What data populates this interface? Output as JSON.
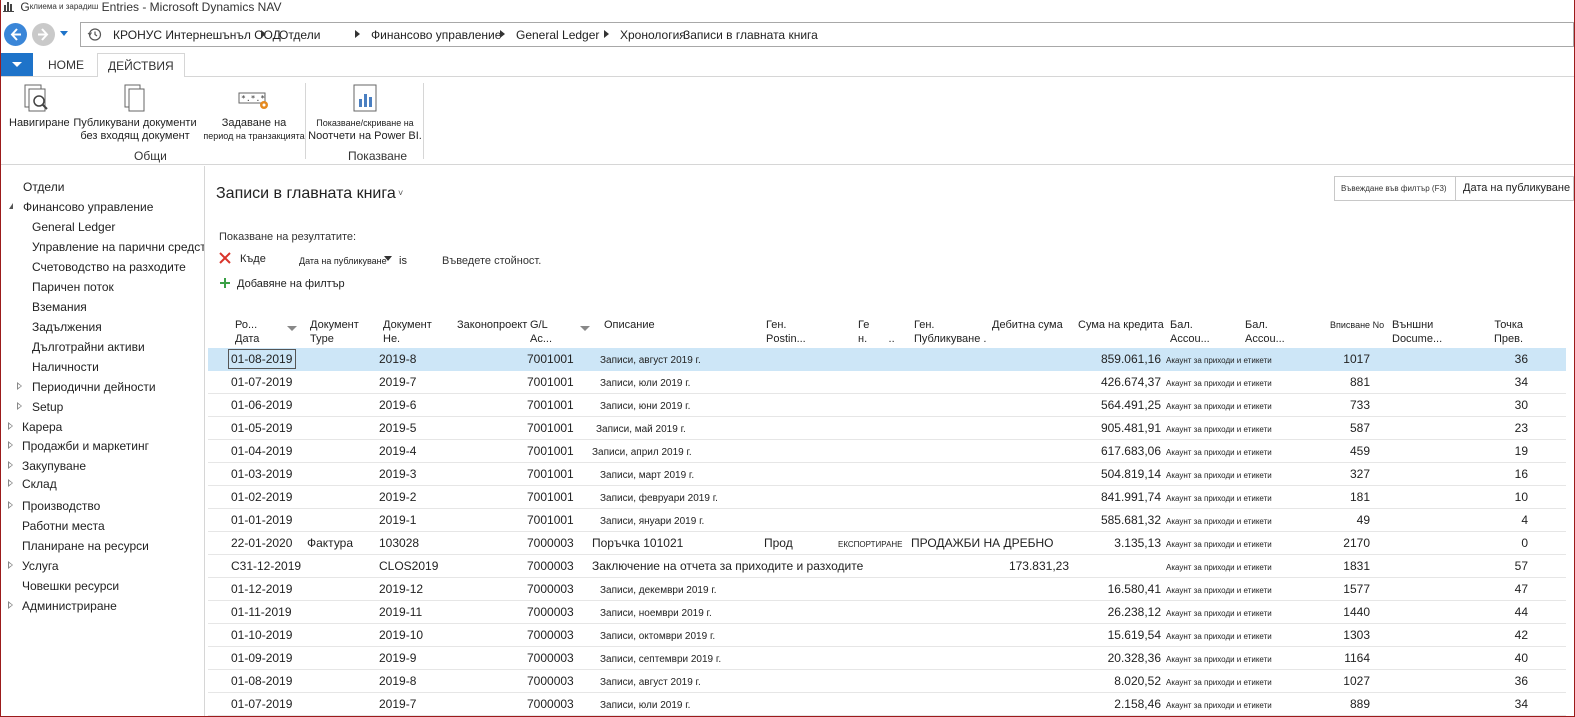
{
  "window": {
    "title_prefix": "G",
    "title_small": "клиема и зарадиш",
    "title_main": "Entries - Microsoft Dynamics NAV"
  },
  "breadcrumb": {
    "items": [
      "КРОНУС Интернешънъл ООД",
      "Отдели",
      "Финансово управление",
      "General Ledger",
      "Хронология",
      "Записи в главната книга"
    ]
  },
  "ribbon": {
    "tabs": {
      "home": "HOME",
      "actions": "ДЕЙСТВИЯ"
    },
    "buttons": {
      "navigate": "Навигиране",
      "posted_docs_line1": "Публикувани документи",
      "posted_docs_line2": "без входящ документ",
      "set_period_line1": "Задаване на",
      "set_period_line2": "период на транзакцията",
      "show_hide_line1": "Показване/скриване на",
      "show_hide_line2": "Nоотчети на Power BI."
    },
    "groups": {
      "general": "Общи",
      "show": "Показване"
    }
  },
  "leftnav": {
    "items": [
      {
        "label": "Отдели"
      },
      {
        "label": "Финансово управление"
      },
      {
        "label": "General Ledger"
      },
      {
        "label": "Управление на парични средства"
      },
      {
        "label": "Счетоводство на разходите"
      },
      {
        "label": "Паричен поток"
      },
      {
        "label": "Вземания"
      },
      {
        "label": "Задължения"
      },
      {
        "label": "Дълготрайни активи"
      },
      {
        "label": "Наличности"
      },
      {
        "label": "Периодични дейности"
      },
      {
        "label": "Setup"
      },
      {
        "label": "Карера"
      },
      {
        "label": "Продажби и маркетинг"
      },
      {
        "label": "Закупуване"
      },
      {
        "label": "Склад"
      },
      {
        "label": "Производство"
      },
      {
        "label": "Работни места"
      },
      {
        "label": "Планиране на ресурси"
      },
      {
        "label": "Услуга"
      },
      {
        "label": "Човешки ресурси"
      },
      {
        "label": "Администриране"
      }
    ]
  },
  "main": {
    "title": "Записи в главната книга",
    "title_caret": "˅",
    "search": {
      "hint": "Въвеждане във филтър (F3)",
      "field": "Дата на публикуване"
    },
    "filter": {
      "label": "Показване на резултатите:",
      "where": "Къде",
      "field": "Дата на публикуване",
      "operator": "is",
      "value": "Въведете стойност.",
      "add": "Добавяне на филтър"
    }
  },
  "table": {
    "headers": {
      "posting_date_1": "Ро...",
      "posting_date_2": "Дата",
      "doc_type_1": "Документ",
      "doc_type_2": "Type",
      "doc_no_1": "Документ",
      "doc_no_2": "Не.",
      "bill": "Законопроект",
      "gl_1": "G/L",
      "gl_2": "Ac...",
      "description": "Описание",
      "gen_posting_1": "Ген.",
      "gen_posting_2": "Postin...",
      "ge_1": "Ге",
      "ge_2": "н.",
      "ge_dots": "..",
      "gen_pub_1": "Ген.",
      "gen_pub_2": "Публикуване .",
      "debit": "Дебитна сума",
      "credit": "Сума на кредита",
      "bal_1": "Бал.",
      "bal_2": "Accou...",
      "bal2_1": "Бал.",
      "bal2_2": "Accou...",
      "entry_no": "Вписване No",
      "ext_doc_1": "Външни",
      "ext_doc_2": "Docume...",
      "point_1": "Точка",
      "point_2": "Прев."
    },
    "rows": [
      {
        "date": "01-08-2019",
        "doc_type": "",
        "doc_no": "2019-8",
        "gl": "7001001",
        "desc": "Записи, август 2019 г.",
        "gen_post": "",
        "gen_small": "",
        "gen_pub": "",
        "debit": "",
        "credit": "859.061,16",
        "bal": "Акаунт за приходи и етикети",
        "entry": "1017",
        "point": "36",
        "selected": true
      },
      {
        "date": "01-07-2019",
        "doc_type": "",
        "doc_no": "2019-7",
        "gl": "7001001",
        "desc": "Записи, юли 2019 г.",
        "gen_post": "",
        "gen_small": "",
        "gen_pub": "",
        "debit": "",
        "credit": "426.674,37",
        "bal": "Акаунт за приходи и етикети",
        "entry": "881",
        "point": "34"
      },
      {
        "date": "01-06-2019",
        "doc_type": "",
        "doc_no": "2019-6",
        "gl": "7001001",
        "desc": "Записи, юни 2019 г.",
        "gen_post": "",
        "gen_small": "",
        "gen_pub": "",
        "debit": "",
        "credit": "564.491,25",
        "bal": "Акаунт за приходи и етикети",
        "entry": "733",
        "point": "30"
      },
      {
        "date": "01-05-2019",
        "doc_type": "",
        "doc_no": "2019-5",
        "gl": "7001001",
        "desc": "Записи, май 2019 г.",
        "gen_post": "",
        "gen_small": "",
        "gen_pub": "",
        "debit": "",
        "credit": "905.481,91",
        "bal": "Акаунт за приходи и етикети",
        "entry": "587",
        "point": "23"
      },
      {
        "date": "01-04-2019",
        "doc_type": "",
        "doc_no": "2019-4",
        "gl": "7001001",
        "desc": "Записи, април 2019 г.",
        "gen_post": "",
        "gen_small": "",
        "gen_pub": "",
        "debit": "",
        "credit": "617.683,06",
        "bal": "Акаунт за приходи и етикети",
        "entry": "459",
        "point": "19"
      },
      {
        "date": "01-03-2019",
        "doc_type": "",
        "doc_no": "2019-3",
        "gl": "7001001",
        "desc": "Записи, март 2019 г.",
        "gen_post": "",
        "gen_small": "",
        "gen_pub": "",
        "debit": "",
        "credit": "504.819,14",
        "bal": "Акаунт за приходи и етикети",
        "entry": "327",
        "point": "16"
      },
      {
        "date": "01-02-2019",
        "doc_type": "",
        "doc_no": "2019-2",
        "gl": "7001001",
        "desc": "Записи, февруари 2019 г.",
        "gen_post": "",
        "gen_small": "",
        "gen_pub": "",
        "debit": "",
        "credit": "841.991,74",
        "bal": "Акаунт за приходи и етикети",
        "entry": "181",
        "point": "10"
      },
      {
        "date": "01-01-2019",
        "doc_type": "",
        "doc_no": "2019-1",
        "gl": "7001001",
        "desc": "Записи, януари 2019 г.",
        "gen_post": "",
        "gen_small": "",
        "gen_pub": "",
        "debit": "",
        "credit": "585.681,32",
        "bal": "Акаунт за приходи и етикети",
        "entry": "49",
        "point": "4"
      },
      {
        "date": "22-01-2020",
        "doc_type": "Фактура",
        "doc_no": "103028",
        "gl": "7000003",
        "desc": "Поръчка 101021",
        "gen_post": "Прод",
        "gen_small": "ЕКСПОРТИРАНЕ",
        "gen_pub": "ПРОДАЖБИ НА ДРЕБНО",
        "debit": "",
        "credit": "3.135,13",
        "bal": "Акаунт за приходи и етикети",
        "entry": "2170",
        "point": "0"
      },
      {
        "date": "C31-12-2019",
        "doc_type": "",
        "doc_no": "CLOS2019",
        "gl": "7000003",
        "desc": "Заключение на отчета за приходите и разходите",
        "gen_post": "",
        "gen_small": "",
        "gen_pub": "",
        "debit": "173.831,23",
        "credit": "",
        "bal": "Акаунт за приходи и етикети",
        "entry": "1831",
        "point": "57"
      },
      {
        "date": "01-12-2019",
        "doc_type": "",
        "doc_no": "2019-12",
        "gl": "7000003",
        "desc": "Записи, декември 2019 г.",
        "gen_post": "",
        "gen_small": "",
        "gen_pub": "",
        "debit": "",
        "credit": "16.580,41",
        "bal": "Акаунт за приходи и етикети",
        "entry": "1577",
        "point": "47"
      },
      {
        "date": "01-11-2019",
        "doc_type": "",
        "doc_no": "2019-11",
        "gl": "7000003",
        "desc": "Записи, ноември 2019 г.",
        "gen_post": "",
        "gen_small": "",
        "gen_pub": "",
        "debit": "",
        "credit": "26.238,12",
        "bal": "Акаунт за приходи и етикети",
        "entry": "1440",
        "point": "44"
      },
      {
        "date": "01-10-2019",
        "doc_type": "",
        "doc_no": "2019-10",
        "gl": "7000003",
        "desc": "Записи, октомври 2019 г.",
        "gen_post": "",
        "gen_small": "",
        "gen_pub": "",
        "debit": "",
        "credit": "15.619,54",
        "bal": "Акаунт за приходи и етикети",
        "entry": "1303",
        "point": "42"
      },
      {
        "date": "01-09-2019",
        "doc_type": "",
        "doc_no": "2019-9",
        "gl": "7000003",
        "desc": "Записи, септември 2019 г.",
        "gen_post": "",
        "gen_small": "",
        "gen_pub": "",
        "debit": "",
        "credit": "20.328,36",
        "bal": "Акаунт за приходи и етикети",
        "entry": "1164",
        "point": "40"
      },
      {
        "date": "01-08-2019",
        "doc_type": "",
        "doc_no": "2019-8",
        "gl": "7000003",
        "desc": "Записи, август 2019 г.",
        "gen_post": "",
        "gen_small": "",
        "gen_pub": "",
        "debit": "",
        "credit": "8.020,52",
        "bal": "Акаунт за приходи и етикети",
        "entry": "1027",
        "point": "36"
      },
      {
        "date": "01-07-2019",
        "doc_type": "",
        "doc_no": "2019-7",
        "gl": "7000003",
        "desc": "Записи, юли 2019 г.",
        "gen_post": "",
        "gen_small": "",
        "gen_pub": "",
        "debit": "",
        "credit": "2.158,46",
        "bal": "Акаунт за приходи и етикети",
        "entry": "889",
        "point": "34"
      }
    ]
  },
  "colors": {
    "accent": "#1e73c9",
    "selected_row": "#cde6f7",
    "filter_x": "#d9342b",
    "add_plus": "#3aa046"
  }
}
